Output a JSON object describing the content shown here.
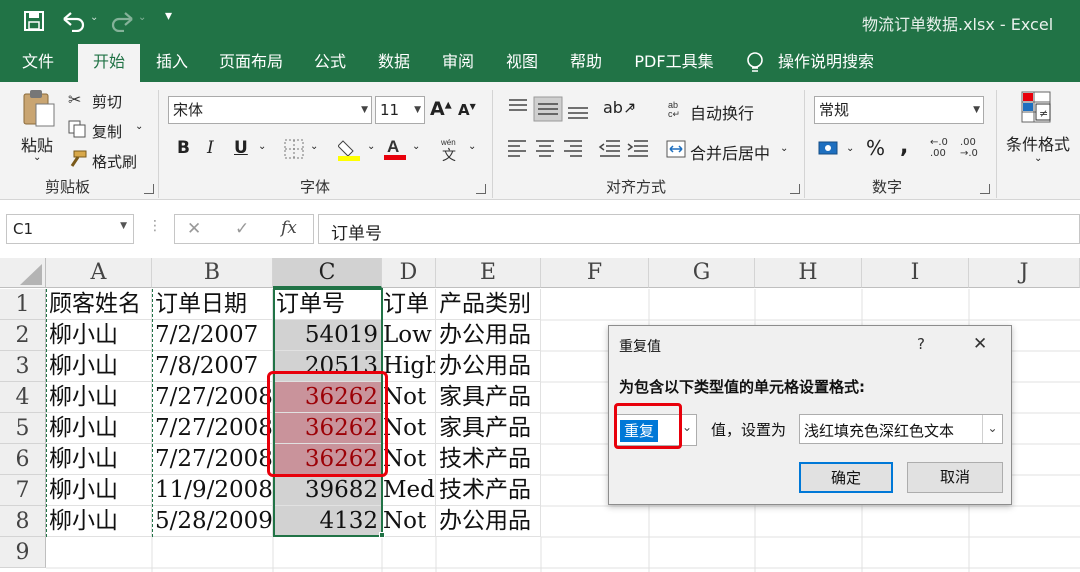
{
  "app": {
    "window_title": "物流订单数据.xlsx  -  Excel"
  },
  "tabs": [
    "文件",
    "开始",
    "插入",
    "页面布局",
    "公式",
    "数据",
    "审阅",
    "视图",
    "帮助",
    "PDF工具集",
    "操作说明搜索"
  ],
  "ribbon": {
    "clipboard": {
      "paste": "粘贴",
      "cut": "剪切",
      "copy": "复制",
      "format_painter": "格式刷",
      "label": "剪贴板"
    },
    "font": {
      "family": "宋体",
      "size": "11",
      "bold": "B",
      "italic": "I",
      "underline": "U",
      "label": "字体"
    },
    "alignment": {
      "wrap_text": "自动换行",
      "merge_center": "合并后居中",
      "label": "对齐方式"
    },
    "number": {
      "format": "常规",
      "percent": "%",
      "comma": ",",
      "inc_decimal": "←.0 .00",
      "dec_decimal": ".00 →.0",
      "label": "数字"
    },
    "styles": {
      "conditional_format": "条件格式"
    }
  },
  "formula_bar": {
    "name_box": "C1",
    "cancel": "✕",
    "enter": "✓",
    "fx": "fx",
    "content": "订单号"
  },
  "sheet": {
    "columns": [
      "A",
      "B",
      "C",
      "D",
      "E",
      "F",
      "G",
      "H",
      "I",
      "J"
    ],
    "rows": [
      "1",
      "2",
      "3",
      "4",
      "5",
      "6",
      "7",
      "8",
      "9"
    ],
    "data": [
      [
        "顾客姓名",
        "订单日期",
        "订单号",
        "订单",
        "产品类别"
      ],
      [
        "柳小山",
        "7/2/2007",
        "54019",
        "Low",
        "办公用品"
      ],
      [
        "柳小山",
        "7/8/2007",
        "20513",
        "High",
        "办公用品"
      ],
      [
        "柳小山",
        "7/27/2008",
        "36262",
        "Not",
        "家具产品"
      ],
      [
        "柳小山",
        "7/27/2008",
        "36262",
        "Not",
        "家具产品"
      ],
      [
        "柳小山",
        "7/27/2008",
        "36262",
        "Not",
        "技术产品"
      ],
      [
        "柳小山",
        "11/9/2008",
        "39682",
        "Medi",
        "技术产品"
      ],
      [
        "柳小山",
        "5/28/2009",
        "4132",
        "Not",
        "办公用品"
      ]
    ]
  },
  "dialog": {
    "title": "重复值",
    "help": "?",
    "close": "✕",
    "instruction": "为包含以下类型值的单元格设置格式:",
    "type_value": "重复",
    "connector": "值，设置为",
    "format_value": "浅红填充色深红色文本",
    "ok": "确定",
    "cancel": "取消"
  },
  "colors": {
    "excel_green": "#217346",
    "duplicate_fill": "#c9939b",
    "duplicate_text": "#9c0006",
    "highlight_red": "#e8000b"
  }
}
